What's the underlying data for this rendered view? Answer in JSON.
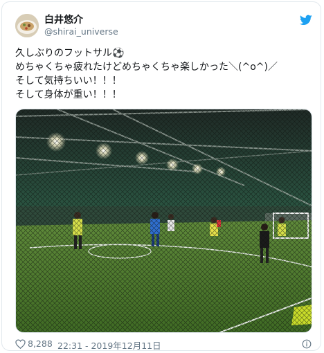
{
  "user": {
    "name": "白井悠介",
    "handle": "@shirai_universe",
    "avatar_icon": "avatar-photo"
  },
  "tweet": {
    "lines": [
      "久しぶりのフットサル⚽",
      "めちゃくちゃ疲れたけどめちゃくちゃ楽しかった＼(^o^)／",
      "そして気持ちいい！！！",
      "そして身体が重い！！！"
    ]
  },
  "media": {
    "description_icon": "futsal-court-photo"
  },
  "footer": {
    "likes": "8,288",
    "timestamp": "22:31 - 2019年12月11日"
  },
  "colors": {
    "brand": "#1da1f2",
    "text": "#14171a",
    "muted": "#657786",
    "border": "#e1e8ed"
  }
}
